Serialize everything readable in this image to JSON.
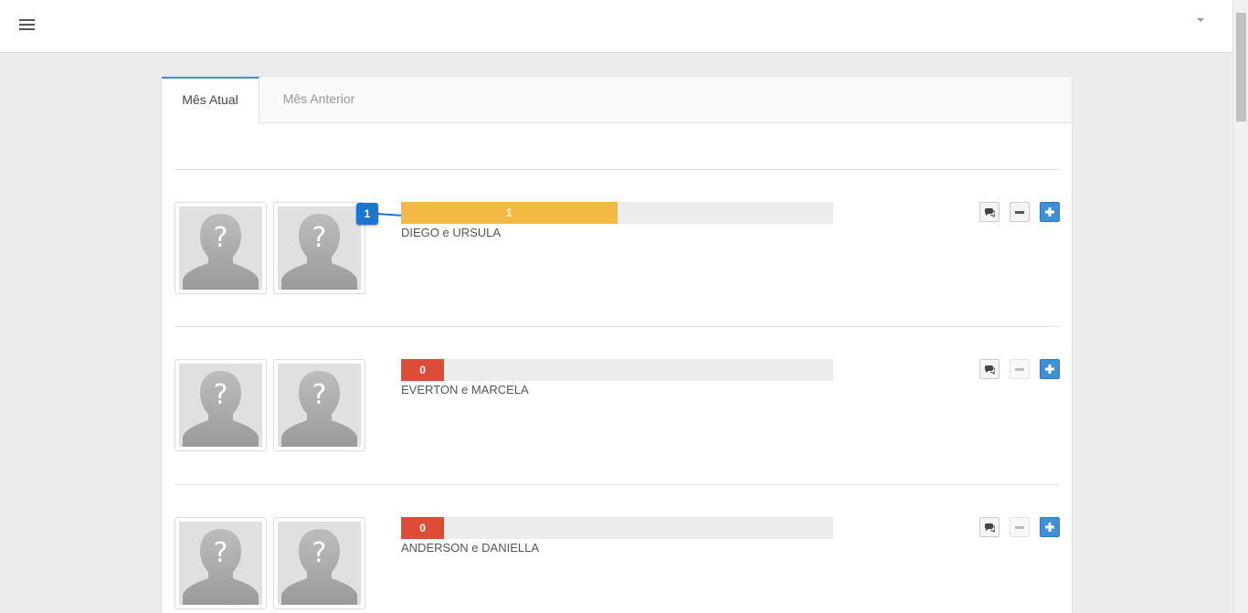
{
  "header": {
    "menu_icon": "hamburger-icon",
    "user_menu_icon": "caret-down-icon"
  },
  "tabs": [
    {
      "label": "Mês Atual",
      "active": true
    },
    {
      "label": "Mês Anterior",
      "active": false
    }
  ],
  "couples": [
    {
      "name": "DIEGO e URSULA",
      "score": "1",
      "progress_percent": 50,
      "bar_color": "#f4b942",
      "rank_badge": "1",
      "minus_enabled": true
    },
    {
      "name": "EVERTON e MARCELA",
      "score": "0",
      "progress_percent": 10,
      "bar_color": "#dd4b39",
      "rank_badge": null,
      "minus_enabled": false
    },
    {
      "name": "ANDERSON e DANIELLA",
      "score": "0",
      "progress_percent": 10,
      "bar_color": "#dd4b39",
      "rank_badge": null,
      "minus_enabled": false
    }
  ],
  "icons": {
    "comment": "comment-icon",
    "minus": "minus-icon",
    "plus": "plus-icon",
    "avatar": "unknown-person-icon"
  },
  "colors": {
    "accent": "#3d8fd6",
    "badge": "#1976d2",
    "warning": "#f4b942",
    "danger": "#dd4b39"
  }
}
